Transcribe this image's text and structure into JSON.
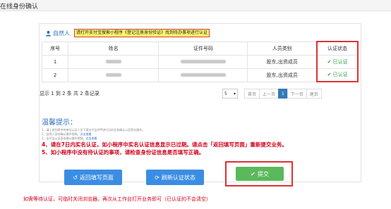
{
  "page": {
    "title": "在线身份确认"
  },
  "notice": {
    "person_label": "自然人",
    "text": "请打开支付宝搜索小程序《登记注册身份验证》找到待办事项进行认证"
  },
  "table": {
    "headers": [
      "序号",
      "姓名",
      "证件号码",
      "人员类别",
      "认证状态"
    ],
    "rows": [
      {
        "no": "1",
        "category": "股东,出资成员",
        "status": "已认证"
      },
      {
        "no": "2",
        "category": "股东,出资成员",
        "status": "已认证"
      }
    ]
  },
  "pagination": {
    "info": "显示 1 到 2 条 共 2 条记录",
    "page_size": "5",
    "first": "首页",
    "prev": "上一页",
    "current": "1",
    "next": "下一页",
    "last": "尾页"
  },
  "tips": {
    "title": "温馨提示：",
    "small_lines": [
      {
        "text": "1、请上述列表中的每位认证人员下载支付宝APP进行扫码业务确认以及签名操作。",
        "link": ""
      },
      {
        "text": "2、自然人身份确认操作视频。",
        "link": "点击查看"
      },
      {
        "text": "3、支付宝认证身份确认操作视频。",
        "link": "点击查看"
      }
    ],
    "red_lines": [
      "4、请在7日内实名认证，如小程序中实名认证信息显示已过期。请点击「返回填写页面」重新提交业务。",
      "5、如小程序中没有待认证的事项，请检查身份证信息是否填写正确。"
    ]
  },
  "buttons": {
    "back": "返回填写页面",
    "refresh": "刷新认证状态",
    "submit": "提交"
  },
  "footer_warning": "如需等待认证，可临时关闭浏览器。再次从工作台打开业务即可（已认证的不会清空）",
  "colors": {
    "primary": "#3b8de3",
    "success": "#5cb85c",
    "verified_text": "#2e9d3c",
    "highlight": "#fff36b",
    "annotation_red": "#dd3333",
    "warning_text": "#d0021b"
  },
  "icons": {
    "person": "user-icon",
    "verified": "check-icon",
    "back": "undo-icon",
    "refresh": "refresh-icon",
    "submit": "check-icon",
    "page_size": "caret-down-icon"
  }
}
